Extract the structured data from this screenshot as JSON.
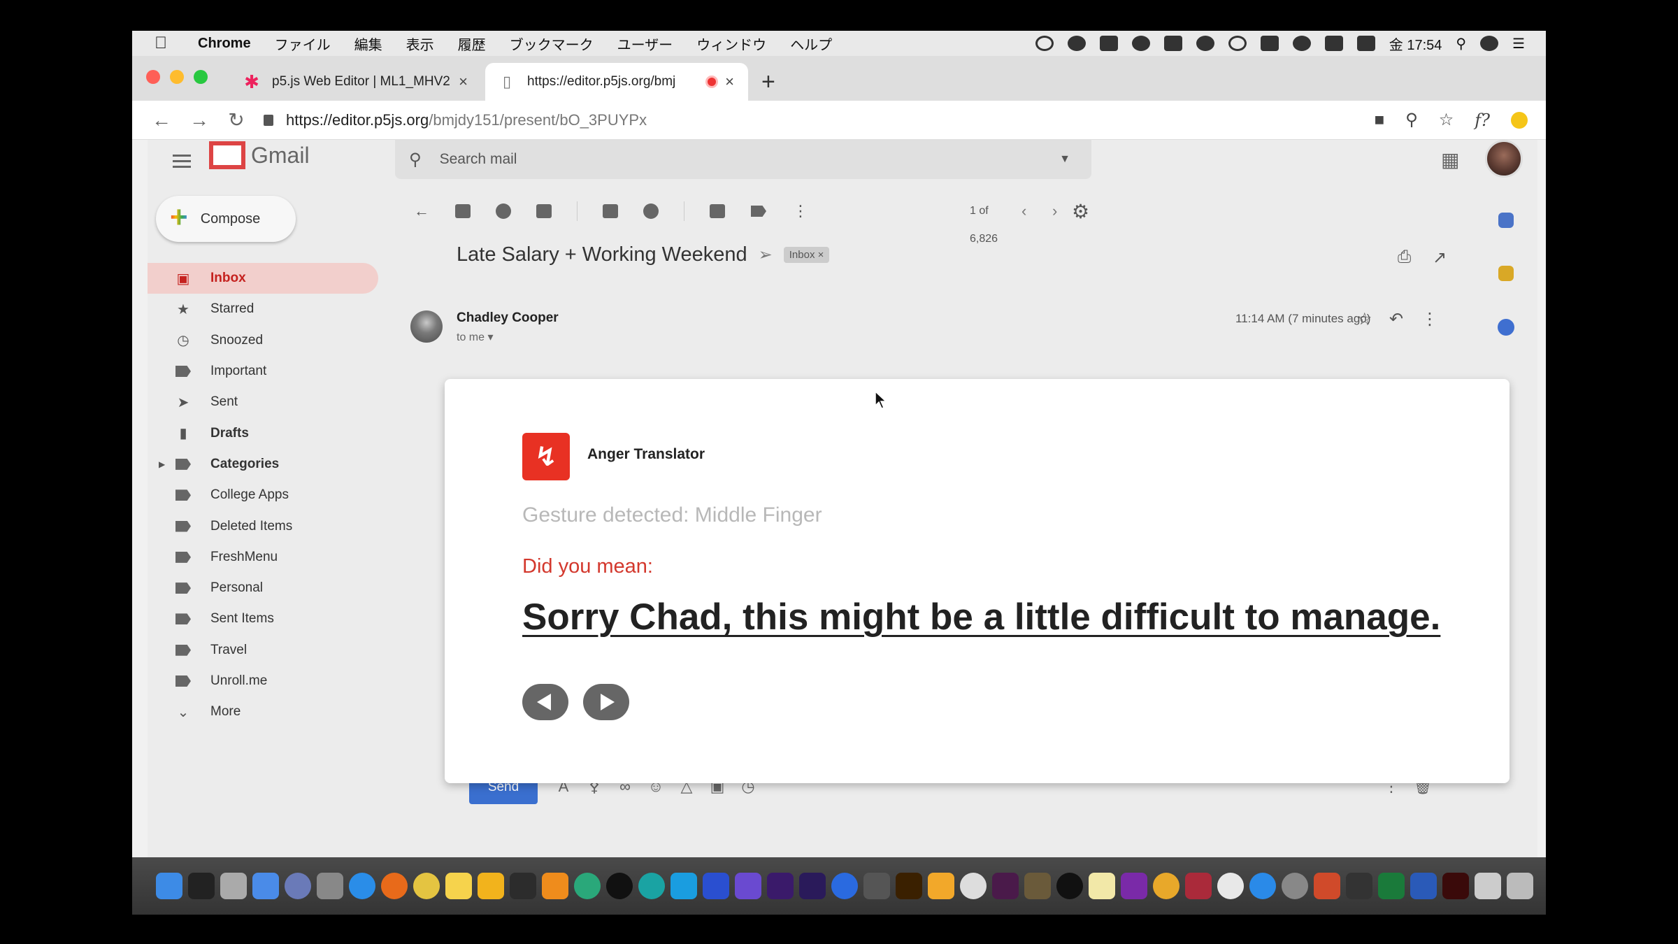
{
  "menubar": {
    "app": "Chrome",
    "items": [
      "ファイル",
      "編集",
      "表示",
      "履歴",
      "ブックマーク",
      "ユーザー",
      "ウィンドウ",
      "ヘルプ"
    ],
    "clock": "金 17:54"
  },
  "tabs": [
    {
      "label": "p5.js Web Editor | ML1_MHV2",
      "close": "×"
    },
    {
      "label": "https://editor.p5js.org/bmj",
      "close": "×"
    }
  ],
  "newtab": "+",
  "address": {
    "url_host": "https://editor.p5js.org",
    "url_path": "/bmjdy151/present/bO_3PUYPx"
  },
  "gmail": {
    "logo_text": "Gmail",
    "search_placeholder": "Search mail",
    "compose": "Compose",
    "nav": [
      {
        "label": "Inbox"
      },
      {
        "label": "Starred"
      },
      {
        "label": "Snoozed"
      },
      {
        "label": "Important"
      },
      {
        "label": "Sent"
      },
      {
        "label": "Drafts"
      },
      {
        "label": "Categories"
      },
      {
        "label": "College Apps"
      },
      {
        "label": "Deleted Items"
      },
      {
        "label": "FreshMenu"
      },
      {
        "label": "Personal"
      },
      {
        "label": "Sent Items"
      },
      {
        "label": "Travel"
      },
      {
        "label": "Unroll.me"
      },
      {
        "label": "More"
      }
    ],
    "pagination": "1 of 6,826",
    "subject": "Late Salary + Working Weekend",
    "inbox_chip": "Inbox ×",
    "sender": "Chadley Cooper",
    "to": "to me",
    "time": "11:14 AM (7 minutes ago)",
    "send": "Send",
    "dots": "•••"
  },
  "overlay": {
    "app_name": "Anger Translator",
    "gesture": "Gesture detected: Middle Finger",
    "prompt": "Did you mean:",
    "translation": "Sorry Chad, this might be a little difficult to manage."
  },
  "colors": {
    "accent_red": "#e83123",
    "prompt_red": "#d3382d",
    "send_blue": "#3a6fcf",
    "inbox_active": "#f2cfcc"
  }
}
